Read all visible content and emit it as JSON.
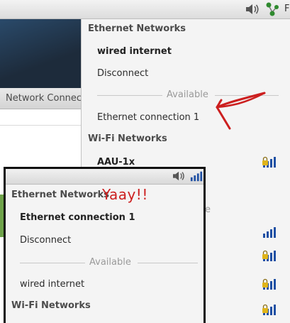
{
  "tray": {
    "sound_icon": "speaker-volume-icon",
    "network_icon": "network-connected-icon",
    "overflow_text": "F"
  },
  "background_window": {
    "title": "Network Connect"
  },
  "menu": {
    "ethernet_header": "Ethernet Networks",
    "active_connection": "wired internet",
    "disconnect_label": "Disconnect",
    "available_label": "Available",
    "available_item": "Ethernet connection 1",
    "wifi_header": "Wi-Fi Networks",
    "wifi_networks": [
      {
        "ssid": "AAU-1x",
        "secured": true
      },
      {
        "ssid": "",
        "secured": false
      },
      {
        "ssid": "",
        "secured": true
      },
      {
        "ssid": "",
        "secured": true
      },
      {
        "ssid": "",
        "secured": true
      }
    ]
  },
  "inset": {
    "ethernet_header": "Ethernet Networks",
    "active_connection": "Ethernet connection 1",
    "disconnect_label": "Disconnect",
    "available_label": "Available",
    "available_item": "wired internet",
    "wifi_header": "Wi-Fi Networks",
    "partial_available_text": "e"
  },
  "annotation": {
    "text": "Yaay!!",
    "color": "#cc1f1f"
  },
  "colors": {
    "accent_signal": "#1e4fa3",
    "lock": "#e0b419",
    "annotation_red": "#cc1f1f"
  }
}
